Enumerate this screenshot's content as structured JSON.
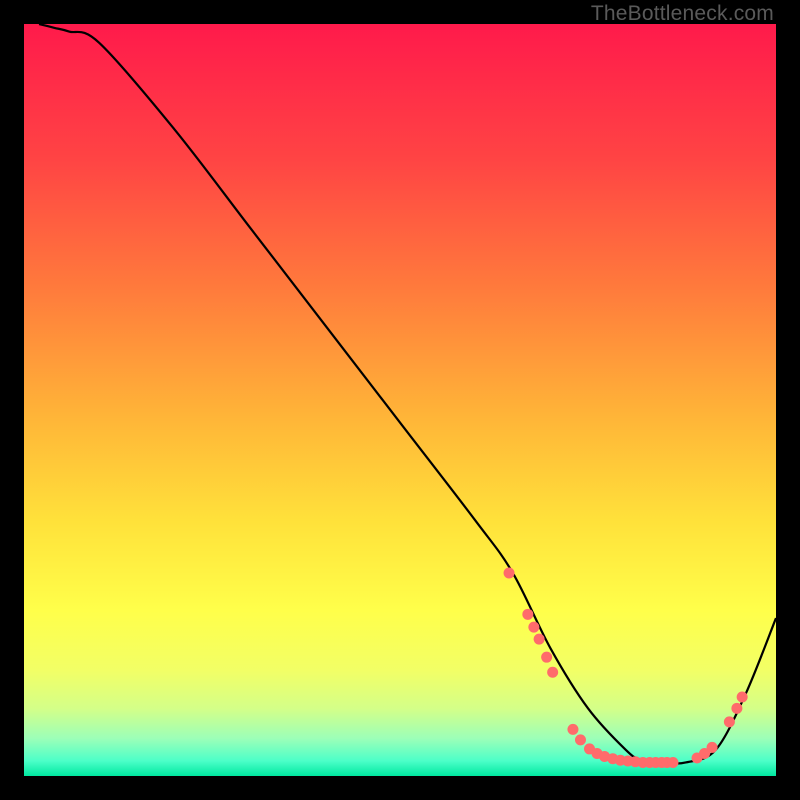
{
  "attribution": "TheBottleneck.com",
  "chart_data": {
    "type": "line",
    "title": "",
    "xlabel": "",
    "ylabel": "",
    "xlim": [
      0,
      100
    ],
    "ylim": [
      0,
      100
    ],
    "gradient_stops": [
      {
        "offset": 0,
        "color": "#ff1a4b"
      },
      {
        "offset": 18,
        "color": "#ff4444"
      },
      {
        "offset": 35,
        "color": "#ff7a3c"
      },
      {
        "offset": 52,
        "color": "#ffb438"
      },
      {
        "offset": 66,
        "color": "#ffe13a"
      },
      {
        "offset": 78,
        "color": "#ffff4a"
      },
      {
        "offset": 86,
        "color": "#f2ff66"
      },
      {
        "offset": 91,
        "color": "#d4ff88"
      },
      {
        "offset": 95,
        "color": "#9cffb8"
      },
      {
        "offset": 98,
        "color": "#4cffc8"
      },
      {
        "offset": 100,
        "color": "#00e8a0"
      }
    ],
    "series": [
      {
        "name": "bottleneck-curve",
        "x": [
          2,
          4,
          6,
          10,
          20,
          30,
          40,
          50,
          60,
          65,
          70,
          75,
          80,
          82,
          85,
          88,
          92,
          96,
          100
        ],
        "y": [
          100,
          99.5,
          99,
          97.5,
          86,
          73,
          60,
          47,
          34,
          27,
          17,
          9,
          3.5,
          2.2,
          1.8,
          1.8,
          3.5,
          11,
          21
        ]
      }
    ],
    "markers": {
      "name": "highlight-points",
      "color": "#ff6b6b",
      "points": [
        {
          "x": 64.5,
          "y": 27.0
        },
        {
          "x": 67.0,
          "y": 21.5
        },
        {
          "x": 67.8,
          "y": 19.8
        },
        {
          "x": 68.5,
          "y": 18.2
        },
        {
          "x": 69.5,
          "y": 15.8
        },
        {
          "x": 70.3,
          "y": 13.8
        },
        {
          "x": 73.0,
          "y": 6.2
        },
        {
          "x": 74.0,
          "y": 4.8
        },
        {
          "x": 75.2,
          "y": 3.6
        },
        {
          "x": 76.2,
          "y": 3.0
        },
        {
          "x": 77.2,
          "y": 2.6
        },
        {
          "x": 78.3,
          "y": 2.3
        },
        {
          "x": 79.3,
          "y": 2.1
        },
        {
          "x": 80.3,
          "y": 2.0
        },
        {
          "x": 81.3,
          "y": 1.9
        },
        {
          "x": 82.3,
          "y": 1.8
        },
        {
          "x": 83.2,
          "y": 1.8
        },
        {
          "x": 84.0,
          "y": 1.8
        },
        {
          "x": 84.8,
          "y": 1.8
        },
        {
          "x": 85.5,
          "y": 1.8
        },
        {
          "x": 86.3,
          "y": 1.8
        },
        {
          "x": 89.5,
          "y": 2.4
        },
        {
          "x": 90.5,
          "y": 3.0
        },
        {
          "x": 91.5,
          "y": 3.8
        },
        {
          "x": 93.8,
          "y": 7.2
        },
        {
          "x": 94.8,
          "y": 9.0
        },
        {
          "x": 95.5,
          "y": 10.5
        }
      ]
    }
  }
}
